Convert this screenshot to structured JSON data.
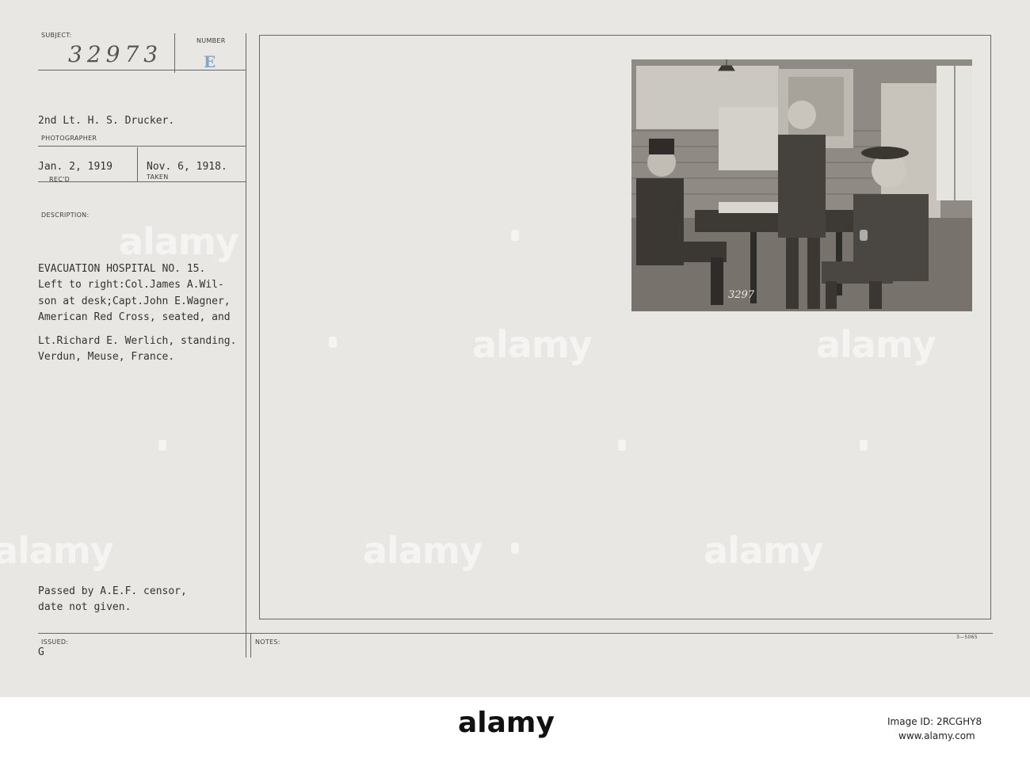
{
  "card": {
    "subject_label": "SUBJECT:",
    "subject_number": "32973",
    "number_label": "NUMBER",
    "number_value": "E",
    "photographer": "2nd Lt. H. S. Drucker.",
    "photographer_label": "PHOTOGRAPHER",
    "received_date": "Jan. 2, 1919",
    "received_label": "REC'D",
    "taken_date": "Nov. 6, 1918.",
    "taken_label": "TAKEN",
    "description_label": "DESCRIPTION:",
    "description_lines": [
      "EVACUATION HOSPITAL NO. 15.",
      "Left to right:Col.James A.Wil-",
      "son at desk;Capt.John E.Wagner,",
      "American Red Cross, seated, and",
      "Lt.Richard E. Werlich, standing.",
      "Verdun, Meuse, France."
    ],
    "censor_lines": [
      "Passed by A.E.F. censor,",
      "date not given."
    ],
    "issued_label": "ISSUED:",
    "issued_value": "G",
    "notes_label": "NOTES:",
    "form_code": "3—5065",
    "photo_number": "3297"
  },
  "watermark": {
    "text": "alamy"
  },
  "footer": {
    "brand": "alamy",
    "image_id_label": "Image ID: 2RCGHY8",
    "site": "www.alamy.com"
  }
}
